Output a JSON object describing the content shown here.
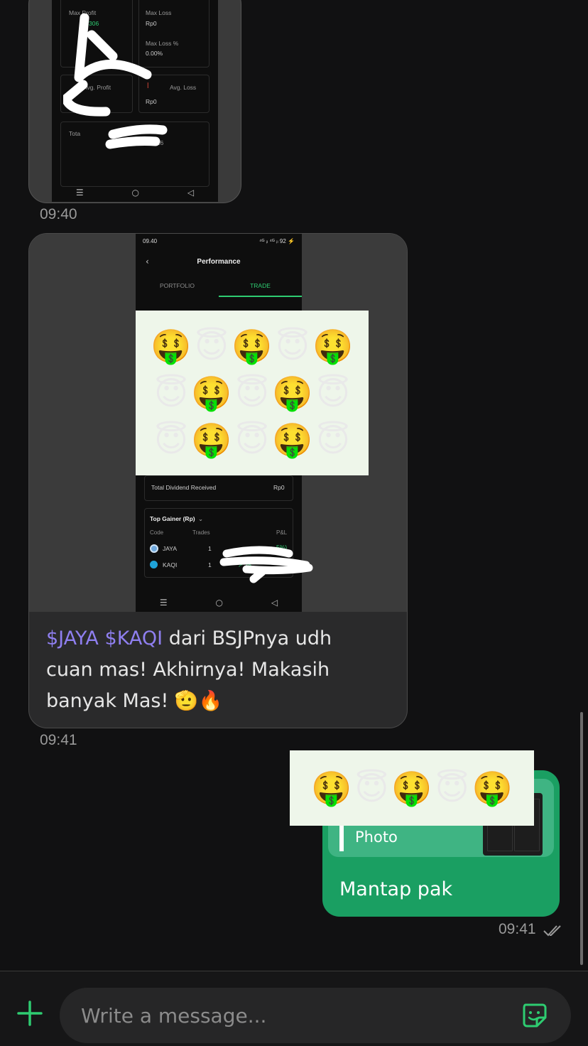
{
  "colors": {
    "background": "#111112",
    "incoming_bubble": "#2a2a2b",
    "outgoing_bubble": "#1a9f62",
    "accent_green": "#2ecc71",
    "cashtag": "#8f7ff0"
  },
  "messages": [
    {
      "type": "image",
      "direction": "incoming",
      "time": "09:40",
      "screenshot": {
        "labels": {
          "max_profit": "Max Profit",
          "max_profit_value_partial": "306",
          "max_loss": "Max Loss",
          "max_loss_value": "Rp0",
          "max_loss_pct": "Max Loss %",
          "max_loss_pct_value": "0.00%",
          "avg_profit": "Avg. Profit",
          "avg_loss": "Avg. Loss",
          "avg_loss_value": "Rp0",
          "total_partial": "Tota",
          "date_range_partial": "26 - 26 Feb 26"
        }
      }
    },
    {
      "type": "image_with_caption",
      "direction": "incoming",
      "time": "09:41",
      "screenshot": {
        "status_time": "09.40",
        "status_icons": "⁴ᴳ ᵢₗ ⁴ᴳ ᵢₗ 92 ⚡",
        "back_icon": "chevron-left-icon",
        "title": "Performance",
        "tabs": [
          "PORTFOLIO",
          "TRADE"
        ],
        "active_tab": "TRADE",
        "dividend_label": "Total Dividend Received",
        "dividend_value": "Rp0",
        "top_gainer_title": "Top Gainer (Rp)",
        "columns": [
          "Code",
          "Trades",
          "P&L"
        ],
        "rows": [
          {
            "code": "JAYA",
            "trades": "1",
            "pnl_partial": "5%)"
          },
          {
            "code": "KAQI",
            "trades": "1",
            "pnl_partial": "↗ 25"
          }
        ]
      },
      "caption": {
        "tag1": "$JAYA",
        "tag2": "$KAQI",
        "text": " dari BSJPnya udh cuan mas! Akhirnya! Makasih banyak Mas! ",
        "emoji": "🫡🔥"
      }
    },
    {
      "type": "reply_text",
      "direction": "outgoing",
      "time": "09:41",
      "status": "read",
      "quote_label": "Photo",
      "text": "Mantap pak"
    }
  ],
  "emoji_overlay": {
    "grid": [
      [
        "🤑",
        "😇",
        "🤑",
        "😇",
        "🤑"
      ],
      [
        "😇",
        "🤑",
        "😇",
        "🤑",
        "😇"
      ],
      [
        "😇",
        "🤑",
        "😇",
        "🤑",
        "😇"
      ]
    ],
    "row": [
      "🤑",
      "😇",
      "🤑",
      "😇",
      "🤑"
    ]
  },
  "composer": {
    "placeholder": "Write a message...",
    "attach_icon": "plus-icon",
    "sticker_icon": "sticker-icon"
  },
  "nav_icons": [
    "menu-icon",
    "home-circle-icon",
    "back-triangle-icon"
  ]
}
